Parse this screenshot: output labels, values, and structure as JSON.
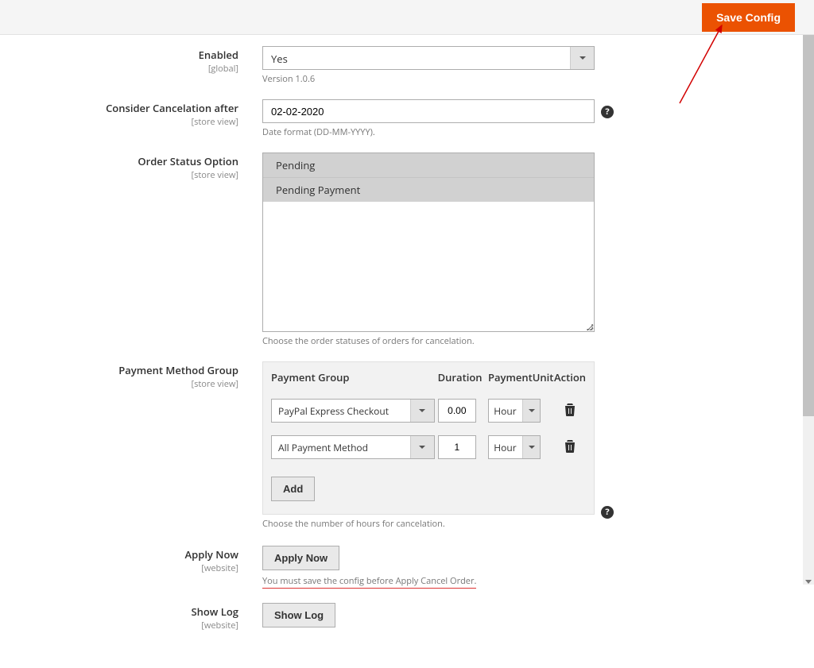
{
  "topbar": {
    "save_label": "Save Config"
  },
  "fields": {
    "enabled": {
      "label": "Enabled",
      "scope": "[global]",
      "value": "Yes",
      "hint": "Version 1.0.6"
    },
    "consider_after": {
      "label": "Consider Cancelation after",
      "scope": "[store view]",
      "value": "02-02-2020",
      "hint": "Date format (DD-MM-YYYY)."
    },
    "order_status": {
      "label": "Order Status Option",
      "scope": "[store view]",
      "options": [
        "Pending",
        "Pending Payment"
      ],
      "hint": "Choose the order statuses of orders for cancelation."
    },
    "payment_group": {
      "label": "Payment Method Group",
      "scope": "[store view]",
      "headers": {
        "group": "Payment Group",
        "duration": "Duration",
        "unit": "PaymentUnit",
        "action": "Action"
      },
      "rows": [
        {
          "group": "PayPal Express Checkout",
          "duration": "0.00",
          "unit": "Hour"
        },
        {
          "group": "All Payment Method",
          "duration": "1",
          "unit": "Hour"
        }
      ],
      "add_label": "Add",
      "hint": "Choose the number of hours for cancelation."
    },
    "apply_now": {
      "label": "Apply Now",
      "scope": "[website]",
      "button": "Apply Now",
      "hint": "You must save the config before Apply Cancel Order."
    },
    "show_log": {
      "label": "Show Log",
      "scope": "[website]",
      "button": "Show Log"
    }
  }
}
